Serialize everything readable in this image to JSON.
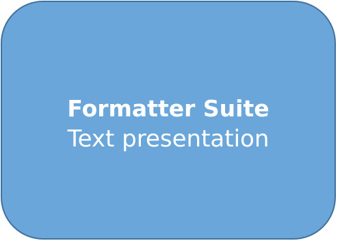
{
  "shape": {
    "title": "Formatter Suite",
    "subtitle": "Text presentation",
    "fill_color": "#6aa6d9",
    "border_color": "#41719c",
    "text_color": "#ffffff"
  }
}
